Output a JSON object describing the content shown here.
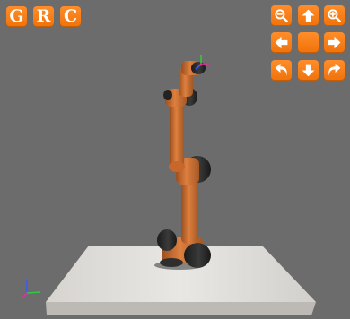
{
  "toolbar_left": {
    "buttons": [
      {
        "label": "G"
      },
      {
        "label": "R"
      },
      {
        "label": "C"
      }
    ]
  },
  "toolbar_right": {
    "icons": [
      "zoom-in-icon",
      "arrow-up-icon",
      "zoom-out-icon",
      "arrow-left-icon",
      "center-icon",
      "arrow-right-icon",
      "rotate-left-icon",
      "arrow-down-icon",
      "rotate-right-icon"
    ]
  },
  "colors": {
    "accent": "#f47a12",
    "viewport_bg": "#6c6c6c",
    "robot_link": "#d97a3d",
    "robot_joint": "#2a2a2a",
    "ground": "#e3e1de"
  }
}
